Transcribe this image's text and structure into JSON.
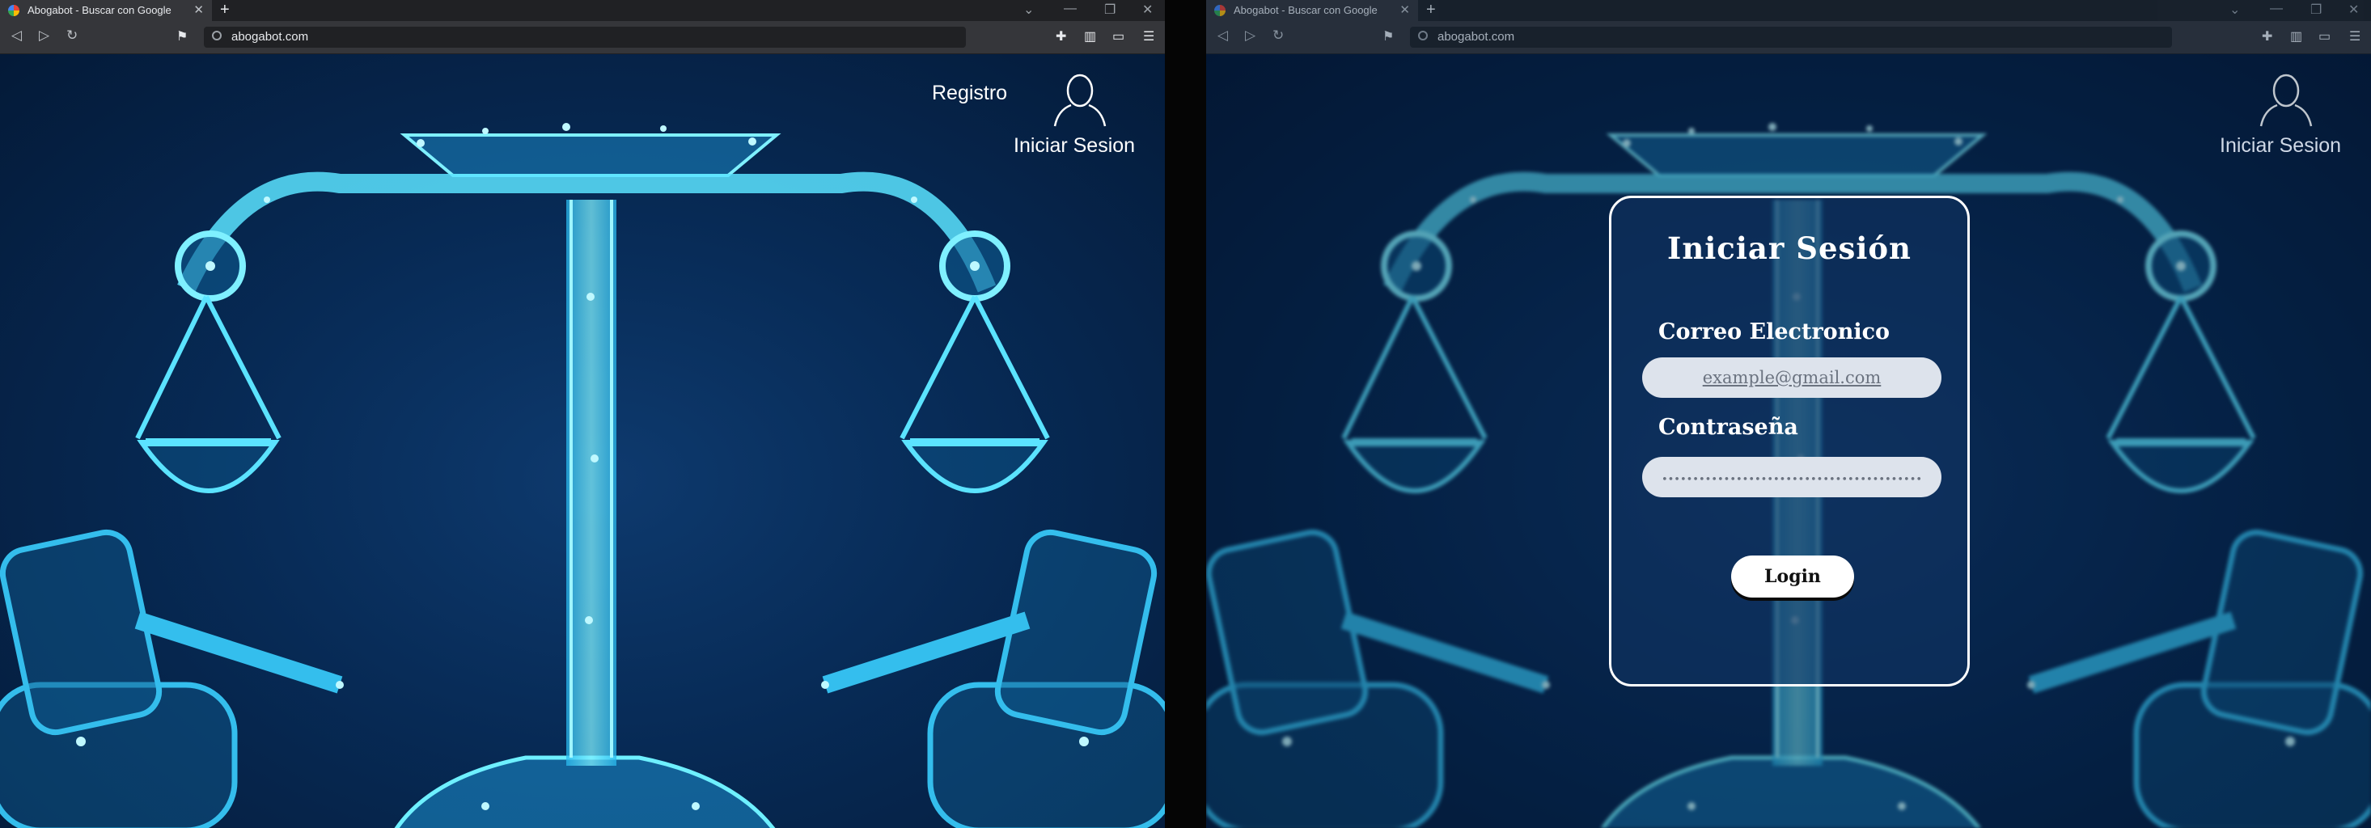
{
  "browser": {
    "tab_title": "Abogabot - Buscar con Google",
    "tab_close": "✕",
    "new_tab": "+",
    "url": "abogabot.com",
    "window_controls": [
      "⌄",
      "—",
      "❐",
      "✕"
    ],
    "nav": [
      "◁",
      "▷",
      "↻"
    ]
  },
  "header": {
    "register_label": "Registro",
    "login_label": "Iniciar Sesion"
  },
  "login_modal": {
    "title": "Iniciar Sesión",
    "email_label": "Correo Electronico",
    "email_placeholder": "example@gmail.com",
    "password_label": "Contraseña",
    "password_placeholder": "••••••••••••••••••••••••••••••••••••••••••",
    "submit_label": "Login"
  },
  "colors": {
    "background": "#06213f",
    "accent_glow": "#3ad6ff",
    "card_border": "#ffffff"
  }
}
